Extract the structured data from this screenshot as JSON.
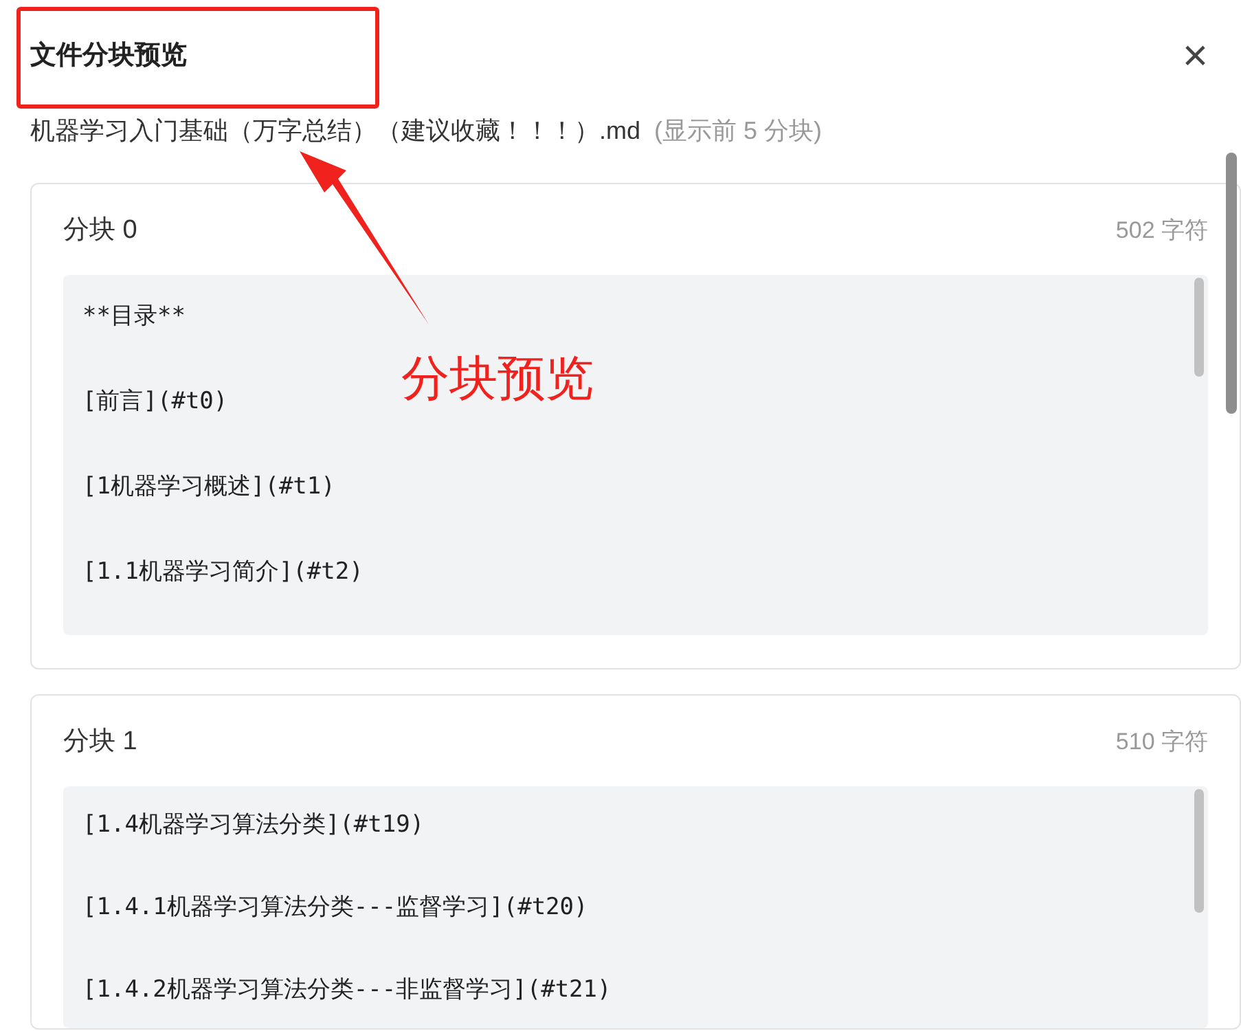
{
  "dialog": {
    "title": "文件分块预览",
    "close_icon": "×",
    "file_name": "机器学习入门基础（万字总结）（建议收藏！！！）.md",
    "file_note": "(显示前 5 分块)"
  },
  "chunks": [
    {
      "title": "分块 0",
      "count": "502 字符",
      "lines": [
        "**目录**",
        "[前言](#t0)",
        "[1机器学习概述](#t1)",
        "[1.1机器学习简介](#t2)"
      ]
    },
    {
      "title": "分块 1",
      "count": "510 字符",
      "lines": [
        "[1.4机器学习算法分类](#t19)",
        "[1.4.1机器学习算法分类---监督学习](#t20)",
        "[1.4.2机器学习算法分类---非监督学习](#t21)"
      ]
    }
  ],
  "annotation": {
    "label": "分块预览"
  }
}
